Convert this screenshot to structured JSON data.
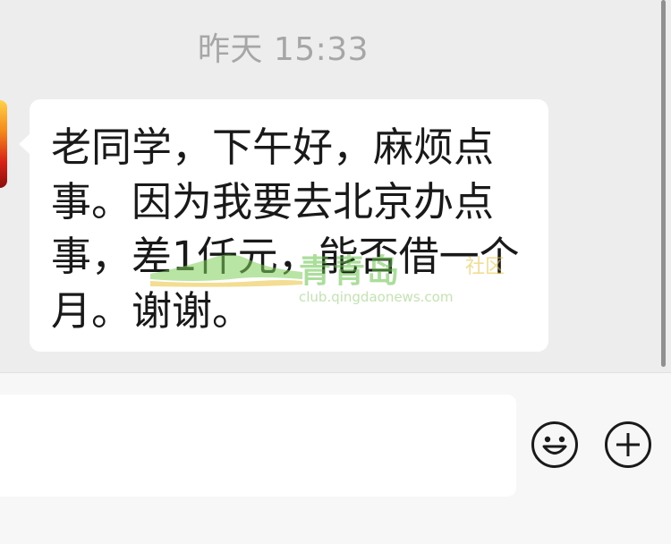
{
  "chat": {
    "timestamp": "昨天 15:33",
    "message": {
      "text": "老同学，下午好，麻烦点事。因为我要去北京办点事，差1仟元，能否借一个月。谢谢。"
    }
  },
  "watermark": {
    "brand": "青青岛",
    "tag": "社区",
    "url": "club.qingdaonews.com"
  },
  "input": {
    "value": "",
    "emoji_icon": "emoji-icon",
    "plus_icon": "plus-icon"
  },
  "colors": {
    "chat_bg": "#ededed",
    "bubble_bg": "#ffffff",
    "input_bar_bg": "#f7f7f7",
    "text": "#191919",
    "timestamp": "#a6a6a6"
  }
}
